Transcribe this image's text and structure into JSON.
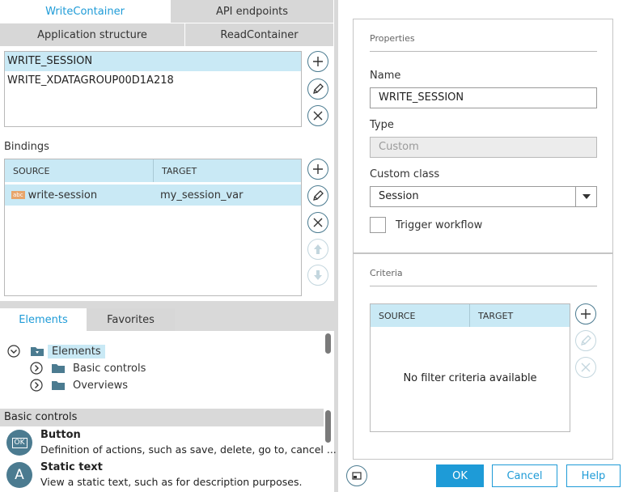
{
  "tabs_top": [
    {
      "label": "WriteContainer",
      "active": true
    },
    {
      "label": "API endpoints",
      "active": false
    }
  ],
  "tabs_second": [
    {
      "label": "Application structure"
    },
    {
      "label": "ReadContainer"
    }
  ],
  "containers": [
    "WRITE_SESSION",
    "WRITE_XDATAGROUP00D1A218"
  ],
  "bindings": {
    "title": "Bindings",
    "col_source": "SOURCE",
    "col_target": "TARGET",
    "rows": [
      {
        "source": "write-session",
        "target": "my_session_var",
        "badge": "abc"
      }
    ]
  },
  "lower_tabs": [
    {
      "label": "Elements",
      "active": true
    },
    {
      "label": "Favorites",
      "active": false
    }
  ],
  "tree": {
    "root": "Elements",
    "children": [
      "Basic controls",
      "Overviews"
    ]
  },
  "controls": {
    "header": "Basic controls",
    "items": [
      {
        "title": "Button",
        "desc": "Definition of actions, such as save, delete, go to, cancel ...",
        "icon": "OK"
      },
      {
        "title": "Static text",
        "desc": "View a static text, such as for description purposes.",
        "icon": "A"
      }
    ]
  },
  "properties": {
    "section": "Properties",
    "name_label": "Name",
    "name_value": "WRITE_SESSION",
    "type_label": "Type",
    "type_value": "Custom",
    "class_label": "Custom class",
    "class_value": "Session",
    "trigger_label": "Trigger workflow"
  },
  "criteria": {
    "section": "Criteria",
    "col_source": "SOURCE",
    "col_target": "TARGET",
    "empty": "No filter criteria available"
  },
  "footer": {
    "ok": "OK",
    "cancel": "Cancel",
    "help": "Help"
  },
  "colors": {
    "accent": "#1e9bd7",
    "selection": "#c9e9f5",
    "icon": "#4b7b90"
  }
}
